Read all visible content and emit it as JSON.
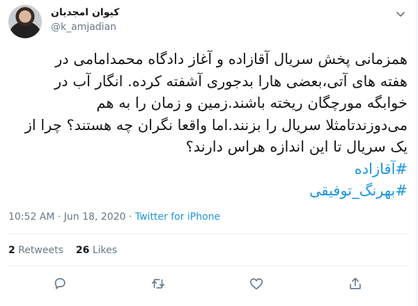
{
  "user": {
    "name": "کیوان امجدیان",
    "handle": "@k_amjadian"
  },
  "tweet": {
    "line1": "همزمانی پخش سریال آقازاده  و آغاز دادگاه محمدامامی در",
    "line2": "هفته های آتی،بعضی هارا بدجوری آشفته کرده. انگار آب در",
    "line3": "خوابگه مورچگان ریخته باشند.زمین و زمان را به هم",
    "line4": "می‌دوزندتامثلا سریال را بزنند.اما واقعا نگران چه هستند؟ چرا از",
    "line5": "یک سریال تا این اندازه هراس دارند؟",
    "hashtag1": "#آقازاده",
    "hashtag2": "#بهرنگ_توفیقی"
  },
  "meta": {
    "time": "10:52 AM · Jun 18, 2020 · ",
    "source": "Twitter for iPhone"
  },
  "stats": {
    "retweets_count": "2",
    "retweets_label": "Retweets",
    "likes_count": "26",
    "likes_label": "Likes"
  },
  "icons": [
    "caret-down-icon",
    "reply-icon",
    "retweet-icon",
    "like-icon",
    "share-icon"
  ],
  "colors": {
    "link": "#1b95e0",
    "muted": "#657786",
    "text": "#14171a"
  }
}
